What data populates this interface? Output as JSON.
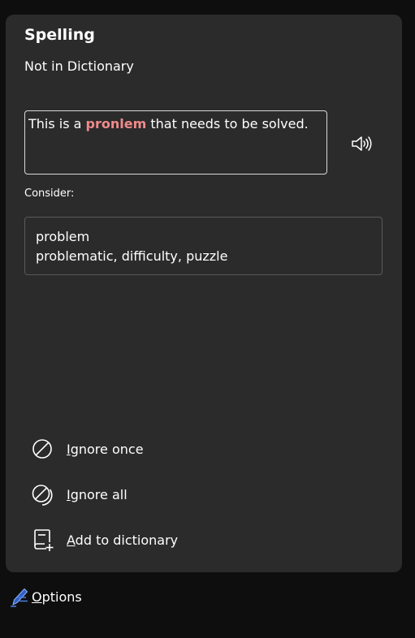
{
  "pane": {
    "title": "Spelling",
    "subtitle": "Not in Dictionary"
  },
  "context": {
    "before": "This is a ",
    "error_word": "pronlem",
    "after": " that needs to be solved."
  },
  "consider_label": "Consider:",
  "suggestion": {
    "word": "problem",
    "synonyms": "problematic, difficulty, puzzle"
  },
  "actions": {
    "ignore_once": {
      "accel": "I",
      "rest": "gnore once",
      "icon": "ignore-once-icon"
    },
    "ignore_all": {
      "accel": "I",
      "rest": "gnore all",
      "icon": "ignore-all-icon"
    },
    "add_to_dictionary": {
      "accel": "A",
      "rest": "dd to dictionary",
      "icon": "add-to-dictionary-icon"
    }
  },
  "options": {
    "accel": "O",
    "rest": "ptions",
    "icon": "options-pen-icon"
  },
  "colors": {
    "background": "#0e0e0e",
    "pane": "#2b2b2b",
    "error_word": "#f08a8a",
    "options_icon": "#4a7fe0"
  }
}
